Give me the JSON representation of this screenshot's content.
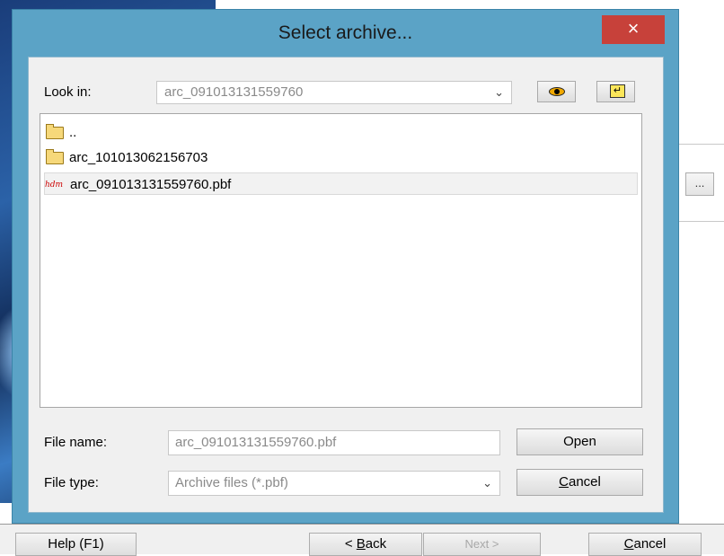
{
  "dialog": {
    "title": "Select archive...",
    "close_glyph": "×",
    "look_in_label": "Look in:",
    "look_in_value": "arc_091013131559760",
    "files": [
      {
        "name": "..",
        "icon": "folder-icon"
      },
      {
        "name": "arc_101013062156703",
        "icon": "folder-icon"
      },
      {
        "name": "arc_091013131559760.pbf",
        "icon": "pbf-file-icon",
        "icon_text": "hdm"
      }
    ],
    "file_name_label": "File name:",
    "file_name_value": "arc_091013131559760.pbf",
    "file_type_label": "File type:",
    "file_type_value": "Archive files (*.pbf)",
    "open_button": "Open",
    "cancel_button_prefix": "",
    "cancel_button_underlined": "C",
    "cancel_button_rest": "ancel"
  },
  "wizard": {
    "ellipsis": "...",
    "help_button": "Help (F1)",
    "back_button_prefix": "< ",
    "back_button_underlined": "B",
    "back_button_rest": "ack",
    "next_button": "Next >",
    "cancel_underlined": "C",
    "cancel_rest": "ancel"
  },
  "colors": {
    "dialog_frame": "#5ba3c6",
    "close_button": "#c7413a",
    "pbf_icon": "#cc0000"
  }
}
